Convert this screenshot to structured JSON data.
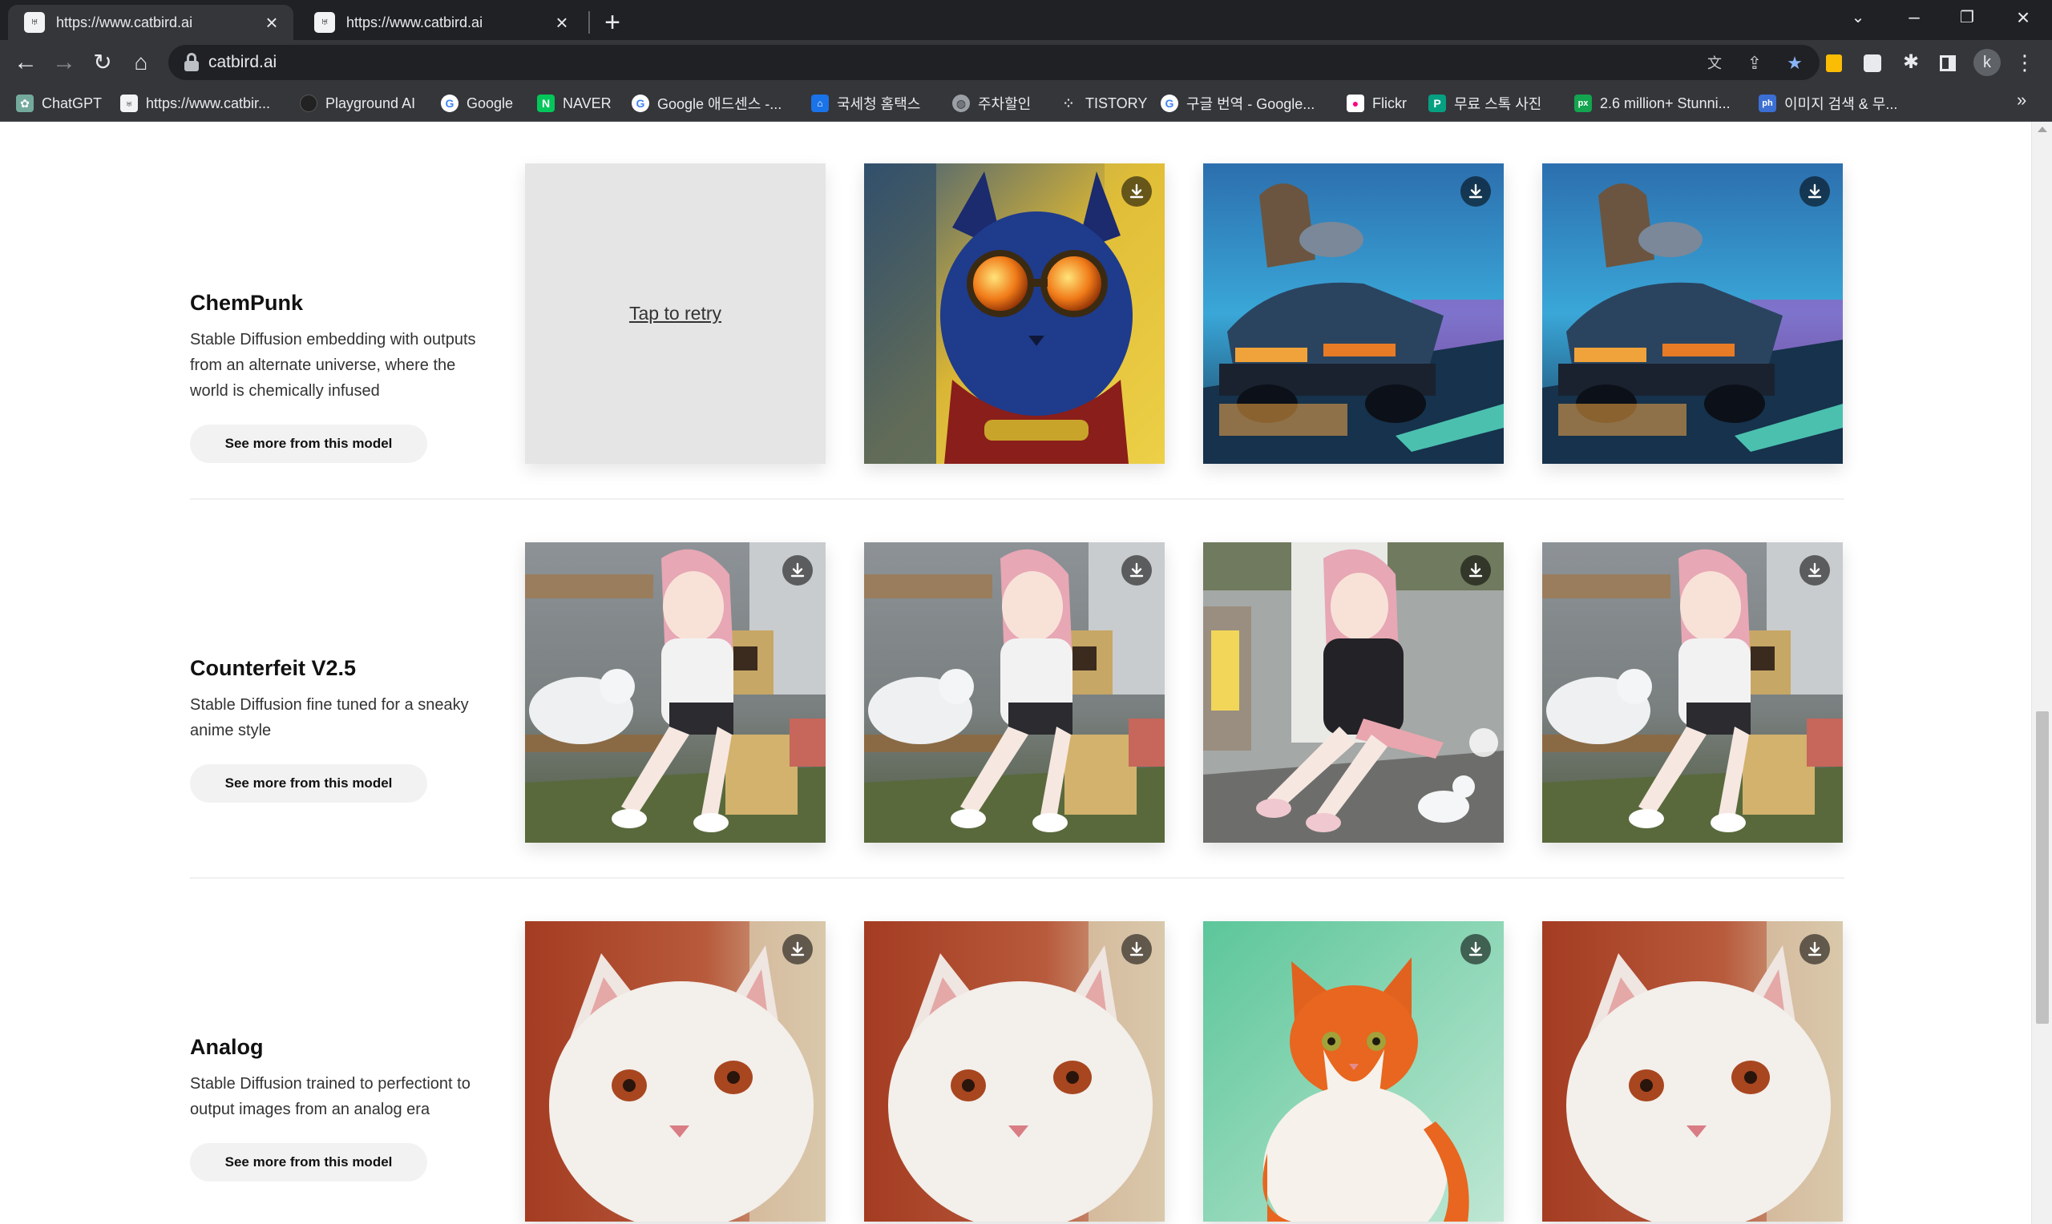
{
  "browser": {
    "tabs": [
      {
        "title": "https://www.catbird.ai"
      },
      {
        "title": "https://www.catbird.ai"
      }
    ],
    "url": "catbird.ai",
    "profile_initial": "k"
  },
  "bookmarks": [
    {
      "label": "ChatGPT",
      "icon_color": "#74aa9c"
    },
    {
      "label": "https://www.catbir...",
      "icon_color": "#f1f3f4"
    },
    {
      "label": "Playground AI",
      "icon_color": "#222222"
    },
    {
      "label": "Google",
      "icon_color": "#4285f4"
    },
    {
      "label": "NAVER",
      "icon_color": "#03c75a"
    },
    {
      "label": "Google 애드센스 -...",
      "icon_color": "#4285f4"
    },
    {
      "label": "국세청 홈택스",
      "icon_color": "#1a73e8"
    },
    {
      "label": "주차할인",
      "icon_color": "#9aa0a6"
    },
    {
      "label": "TISTORY",
      "icon_color": "#e8eaed"
    },
    {
      "label": "구글 번역 - Google...",
      "icon_color": "#4285f4"
    },
    {
      "label": "Flickr",
      "icon_color": "#ff0084"
    },
    {
      "label": "무료 스톡 사진",
      "icon_color": "#05a081"
    },
    {
      "label": "2.6 million+ Stunni...",
      "icon_color": "#13a54f"
    },
    {
      "label": "이미지 검색 & 무...",
      "icon_color": "#3b6fd4"
    }
  ],
  "models": [
    {
      "name": "ChemPunk",
      "description": "Stable Diffusion embedding with outputs from an alternate universe, where the world is chemically infused",
      "button": "See more from this model",
      "images": [
        "retry",
        "goggles-cat",
        "car",
        "car"
      ]
    },
    {
      "name": "Counterfeit V2.5",
      "description": "Stable Diffusion fine tuned for a sneaky anime style",
      "button": "See more from this model",
      "images": [
        "anime-bench",
        "anime-bench",
        "anime-street",
        "anime-bench"
      ]
    },
    {
      "name": "Analog",
      "description": "Stable Diffusion trained to perfectiont to output images from an analog era",
      "button": "See more from this model",
      "images": [
        "white-cat",
        "white-cat",
        "orange-cat",
        "white-cat"
      ]
    }
  ],
  "retry_label": "Tap to retry",
  "accent_star": "#8ab4f8"
}
